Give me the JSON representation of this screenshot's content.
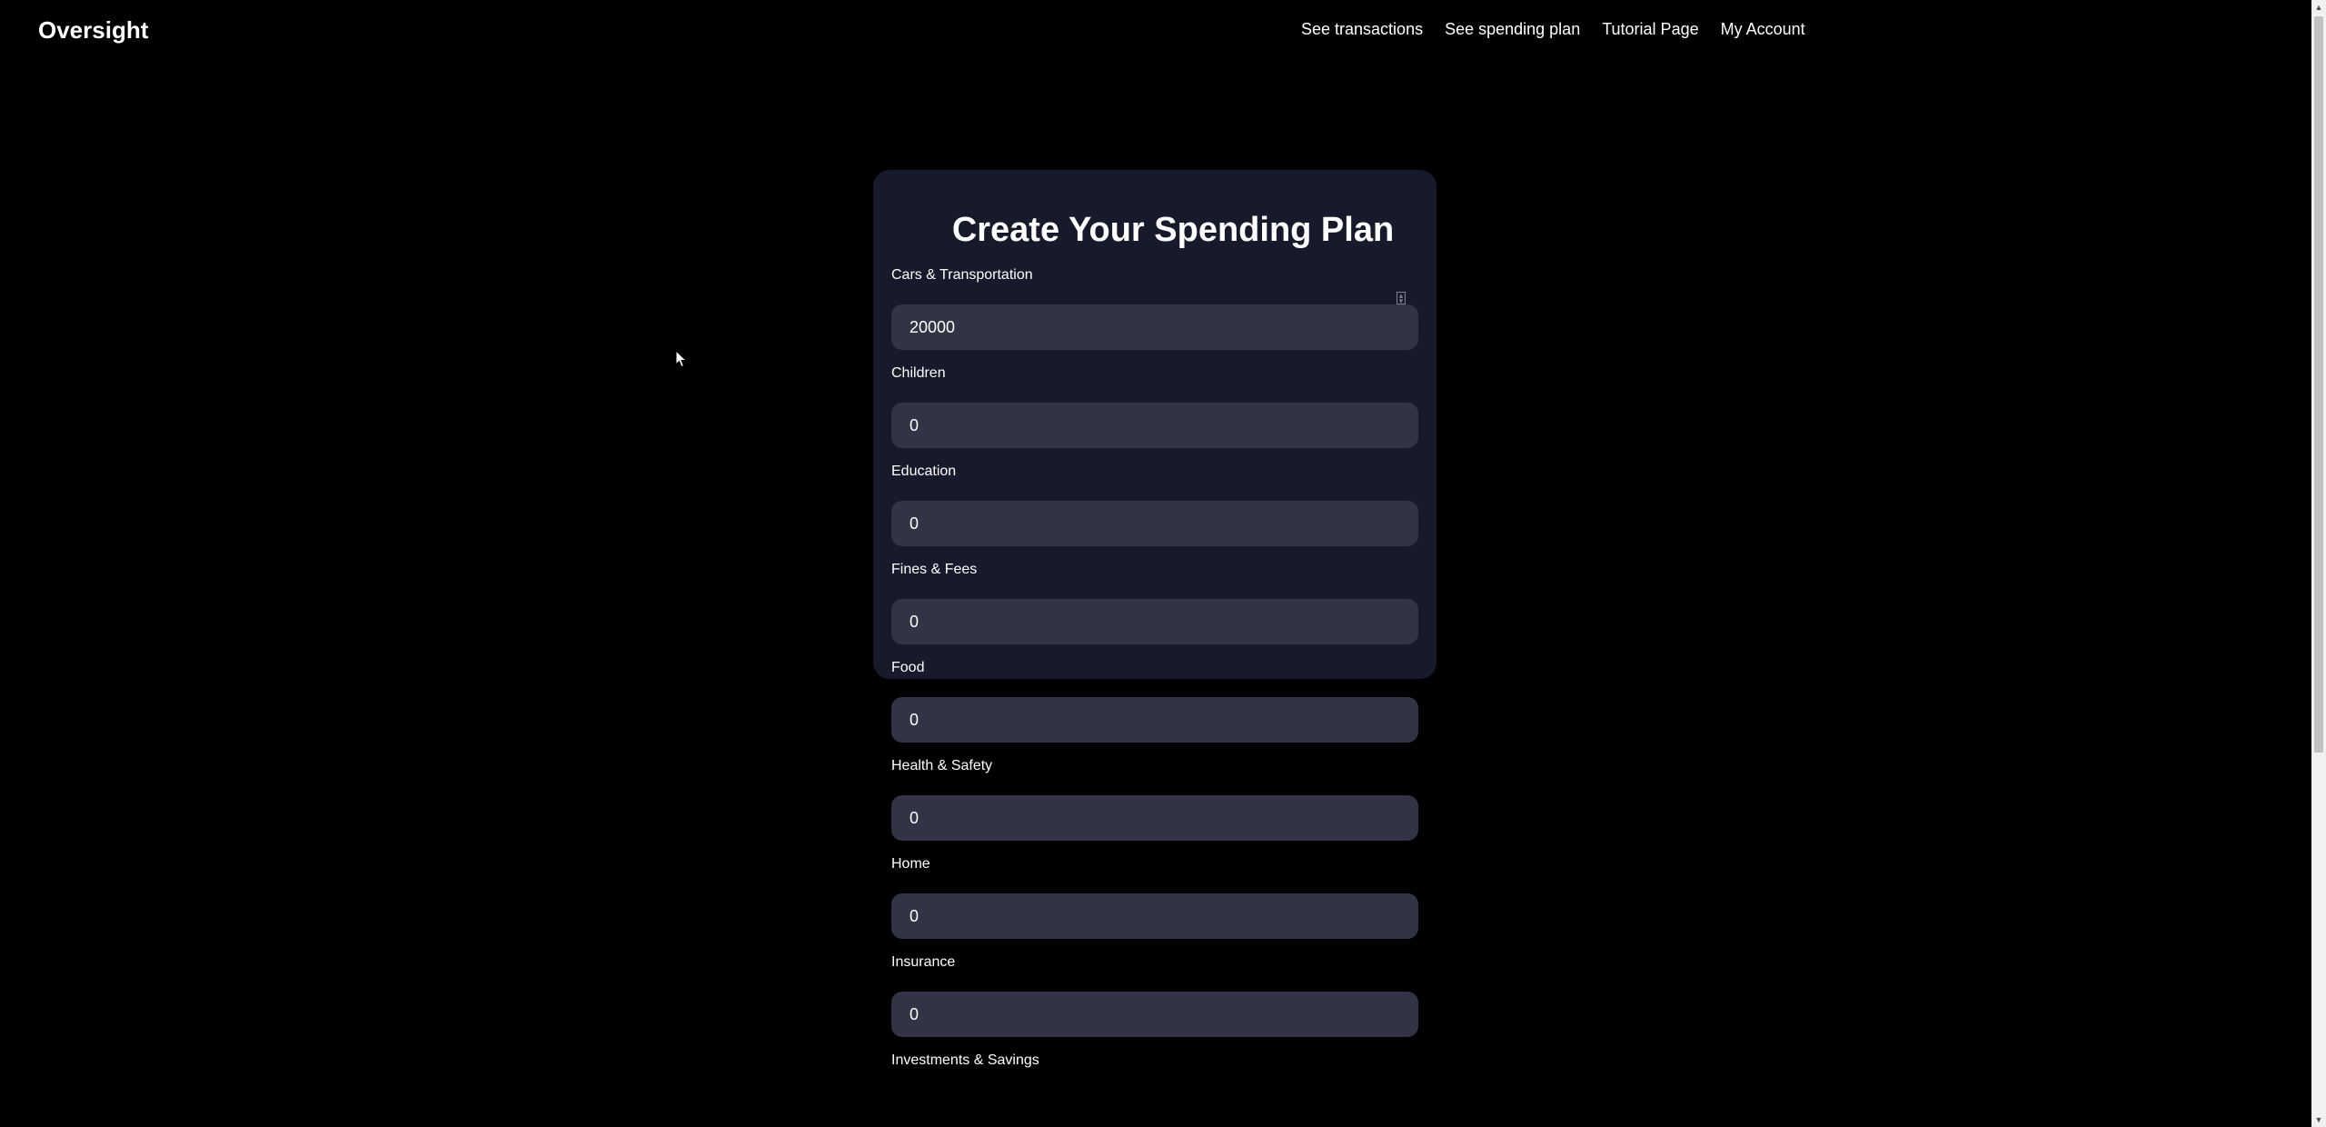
{
  "nav": {
    "brand": "Oversight",
    "links": [
      "See transactions",
      "See spending plan",
      "Tutorial Page",
      "My Account"
    ]
  },
  "form": {
    "title": "Create Your Spending Plan",
    "fields": [
      {
        "label": "Cars & Transportation",
        "value": "20000"
      },
      {
        "label": "Children",
        "value": "0"
      },
      {
        "label": "Education",
        "value": "0"
      },
      {
        "label": "Fines & Fees",
        "value": "0"
      },
      {
        "label": "Food",
        "value": "0"
      },
      {
        "label": "Health & Safety",
        "value": "0"
      },
      {
        "label": "Home",
        "value": "0"
      },
      {
        "label": "Insurance",
        "value": "0"
      },
      {
        "label": "Investments & Savings",
        "value": ""
      }
    ]
  },
  "colors": {
    "background": "#000000",
    "card": "#171a2b",
    "input": "#323446"
  }
}
